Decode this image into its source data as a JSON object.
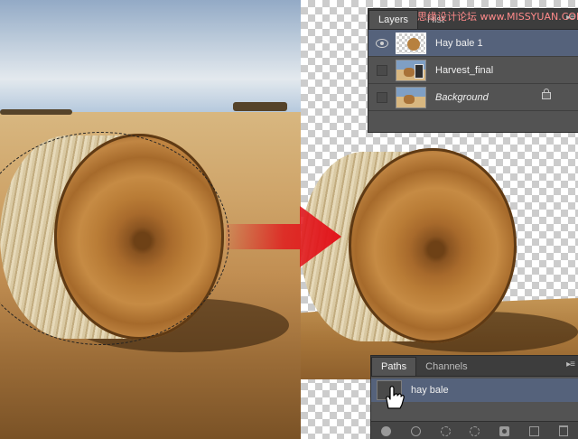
{
  "watermark": "思缘设计论坛 www.MISSYUAN.COM",
  "layers_panel": {
    "tabs": [
      "Layers",
      "Hist"
    ],
    "active_tab": "Layers",
    "layers": [
      {
        "name": "Hay bale 1",
        "visible": true,
        "selected": true,
        "italic": false,
        "locked": false,
        "thumb_icon": "hay-bale-transparent-thumb"
      },
      {
        "name": "Harvest_final",
        "visible": false,
        "selected": false,
        "italic": false,
        "locked": false,
        "thumb_icon": "harvest-photo-thumb"
      },
      {
        "name": "Background",
        "visible": false,
        "selected": false,
        "italic": true,
        "locked": true,
        "thumb_icon": "background-photo-thumb"
      }
    ],
    "menu_icon": "panel-menu-icon"
  },
  "paths_panel": {
    "tabs": [
      "Paths",
      "Channels"
    ],
    "active_tab": "Paths",
    "paths": [
      {
        "name": "hay bale",
        "selected": true
      }
    ],
    "footer_icons": [
      "fill-path-icon",
      "stroke-path-icon",
      "load-as-selection-icon",
      "make-work-path-icon",
      "add-mask-icon",
      "new-path-icon",
      "delete-path-icon"
    ]
  },
  "colors": {
    "panel_bg": "#535353",
    "selected_row": "#55627b",
    "arrow_red": "#e2141a"
  }
}
